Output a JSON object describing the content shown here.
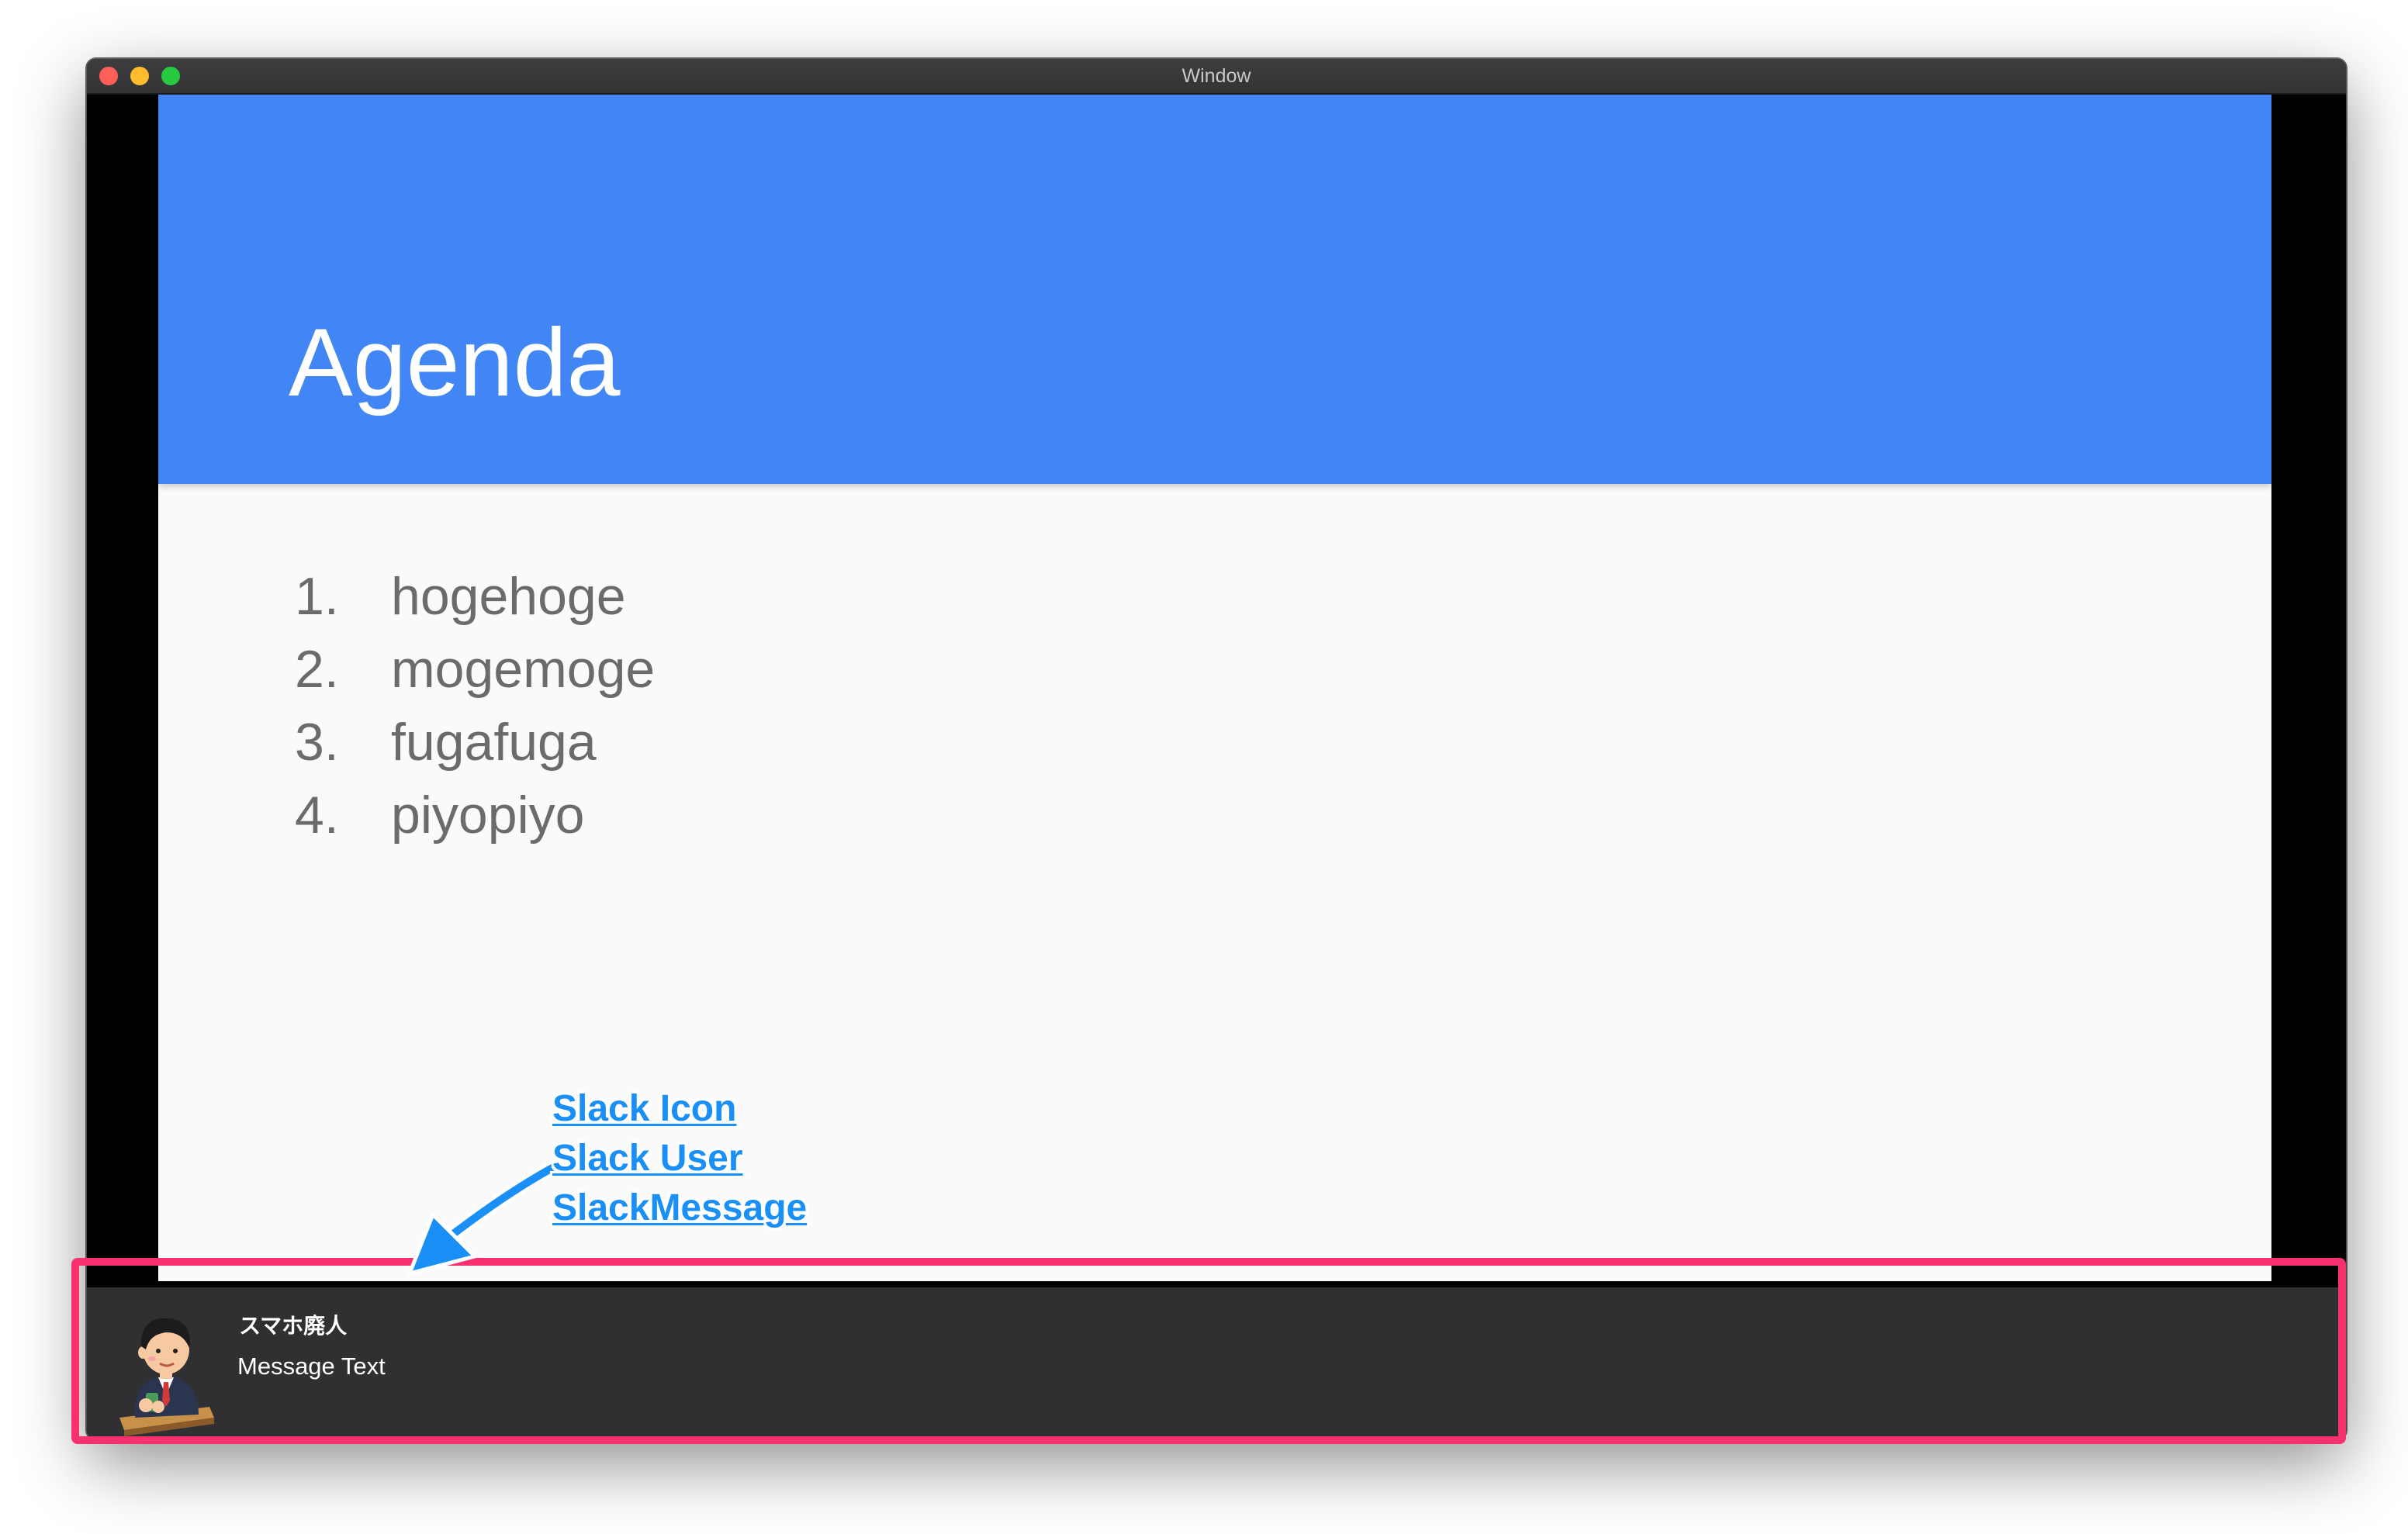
{
  "window": {
    "title": "Window"
  },
  "slide": {
    "title": "Agenda",
    "items": [
      {
        "number": "1.",
        "text": "hogehoge"
      },
      {
        "number": "2.",
        "text": "mogemoge"
      },
      {
        "number": "3.",
        "text": "fugafuga"
      },
      {
        "number": "4.",
        "text": "piyopiyo"
      }
    ]
  },
  "slack": {
    "user": "スマホ廃人",
    "message": "Message Text",
    "icon": "user-avatar-icon"
  },
  "annotation": {
    "labels": [
      "Slack Icon",
      "Slack User",
      "SlackMessage"
    ]
  },
  "colors": {
    "header": "#4285f4",
    "slack_bar": "#303033",
    "highlight": "#f7306e",
    "annotation": "#1a8ff5"
  }
}
